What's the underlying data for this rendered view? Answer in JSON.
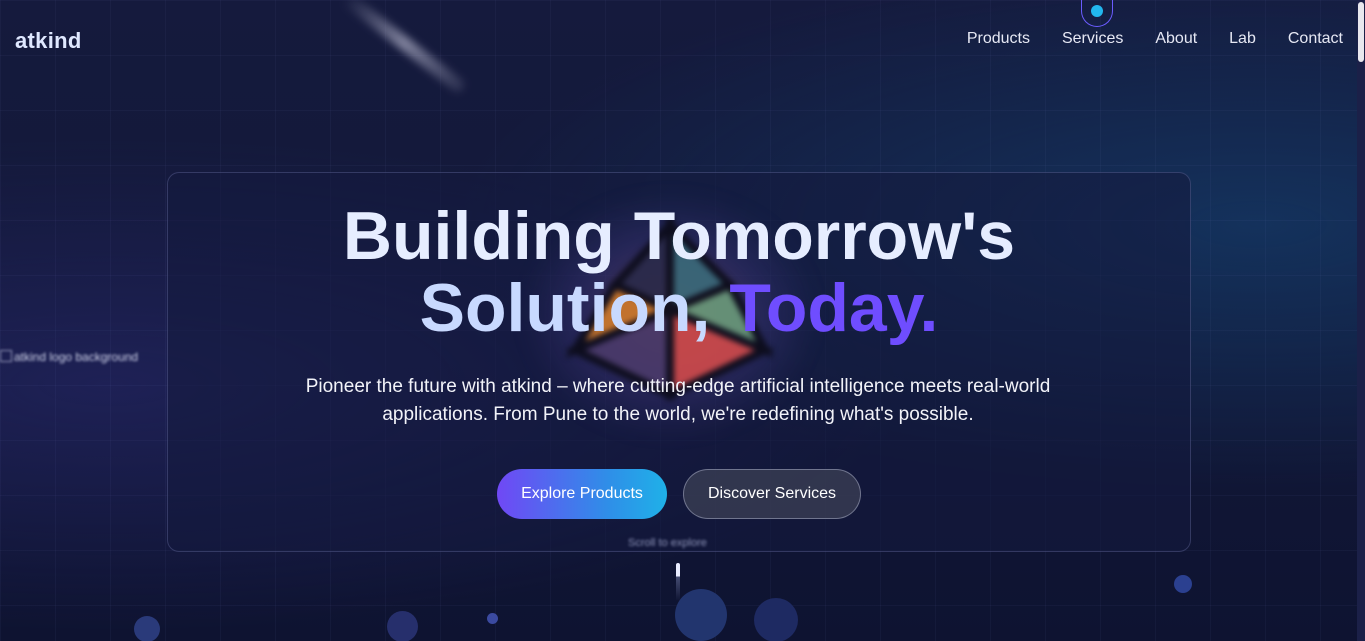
{
  "header": {
    "logo": "atkind",
    "nav": [
      "Products",
      "Services",
      "About",
      "Lab",
      "Contact"
    ]
  },
  "background": {
    "logo_alt_text": "atkind logo background"
  },
  "hero": {
    "title_line1": "Building Tomorrow's",
    "title_line2_plain": "Solution, ",
    "title_line2_accent": "Today.",
    "description": "Pioneer the future with atkind – where cutting-edge artificial intelligence meets real-world applications. From Pune to the world, we're redefining what's possible.",
    "primary_button": "Explore Products",
    "secondary_button": "Discover Services",
    "scroll_hint": "Scroll to explore"
  },
  "colors": {
    "accent_purple": "#6f4dff",
    "accent_cyan": "#1fb1e8",
    "background": "#151a3d"
  }
}
